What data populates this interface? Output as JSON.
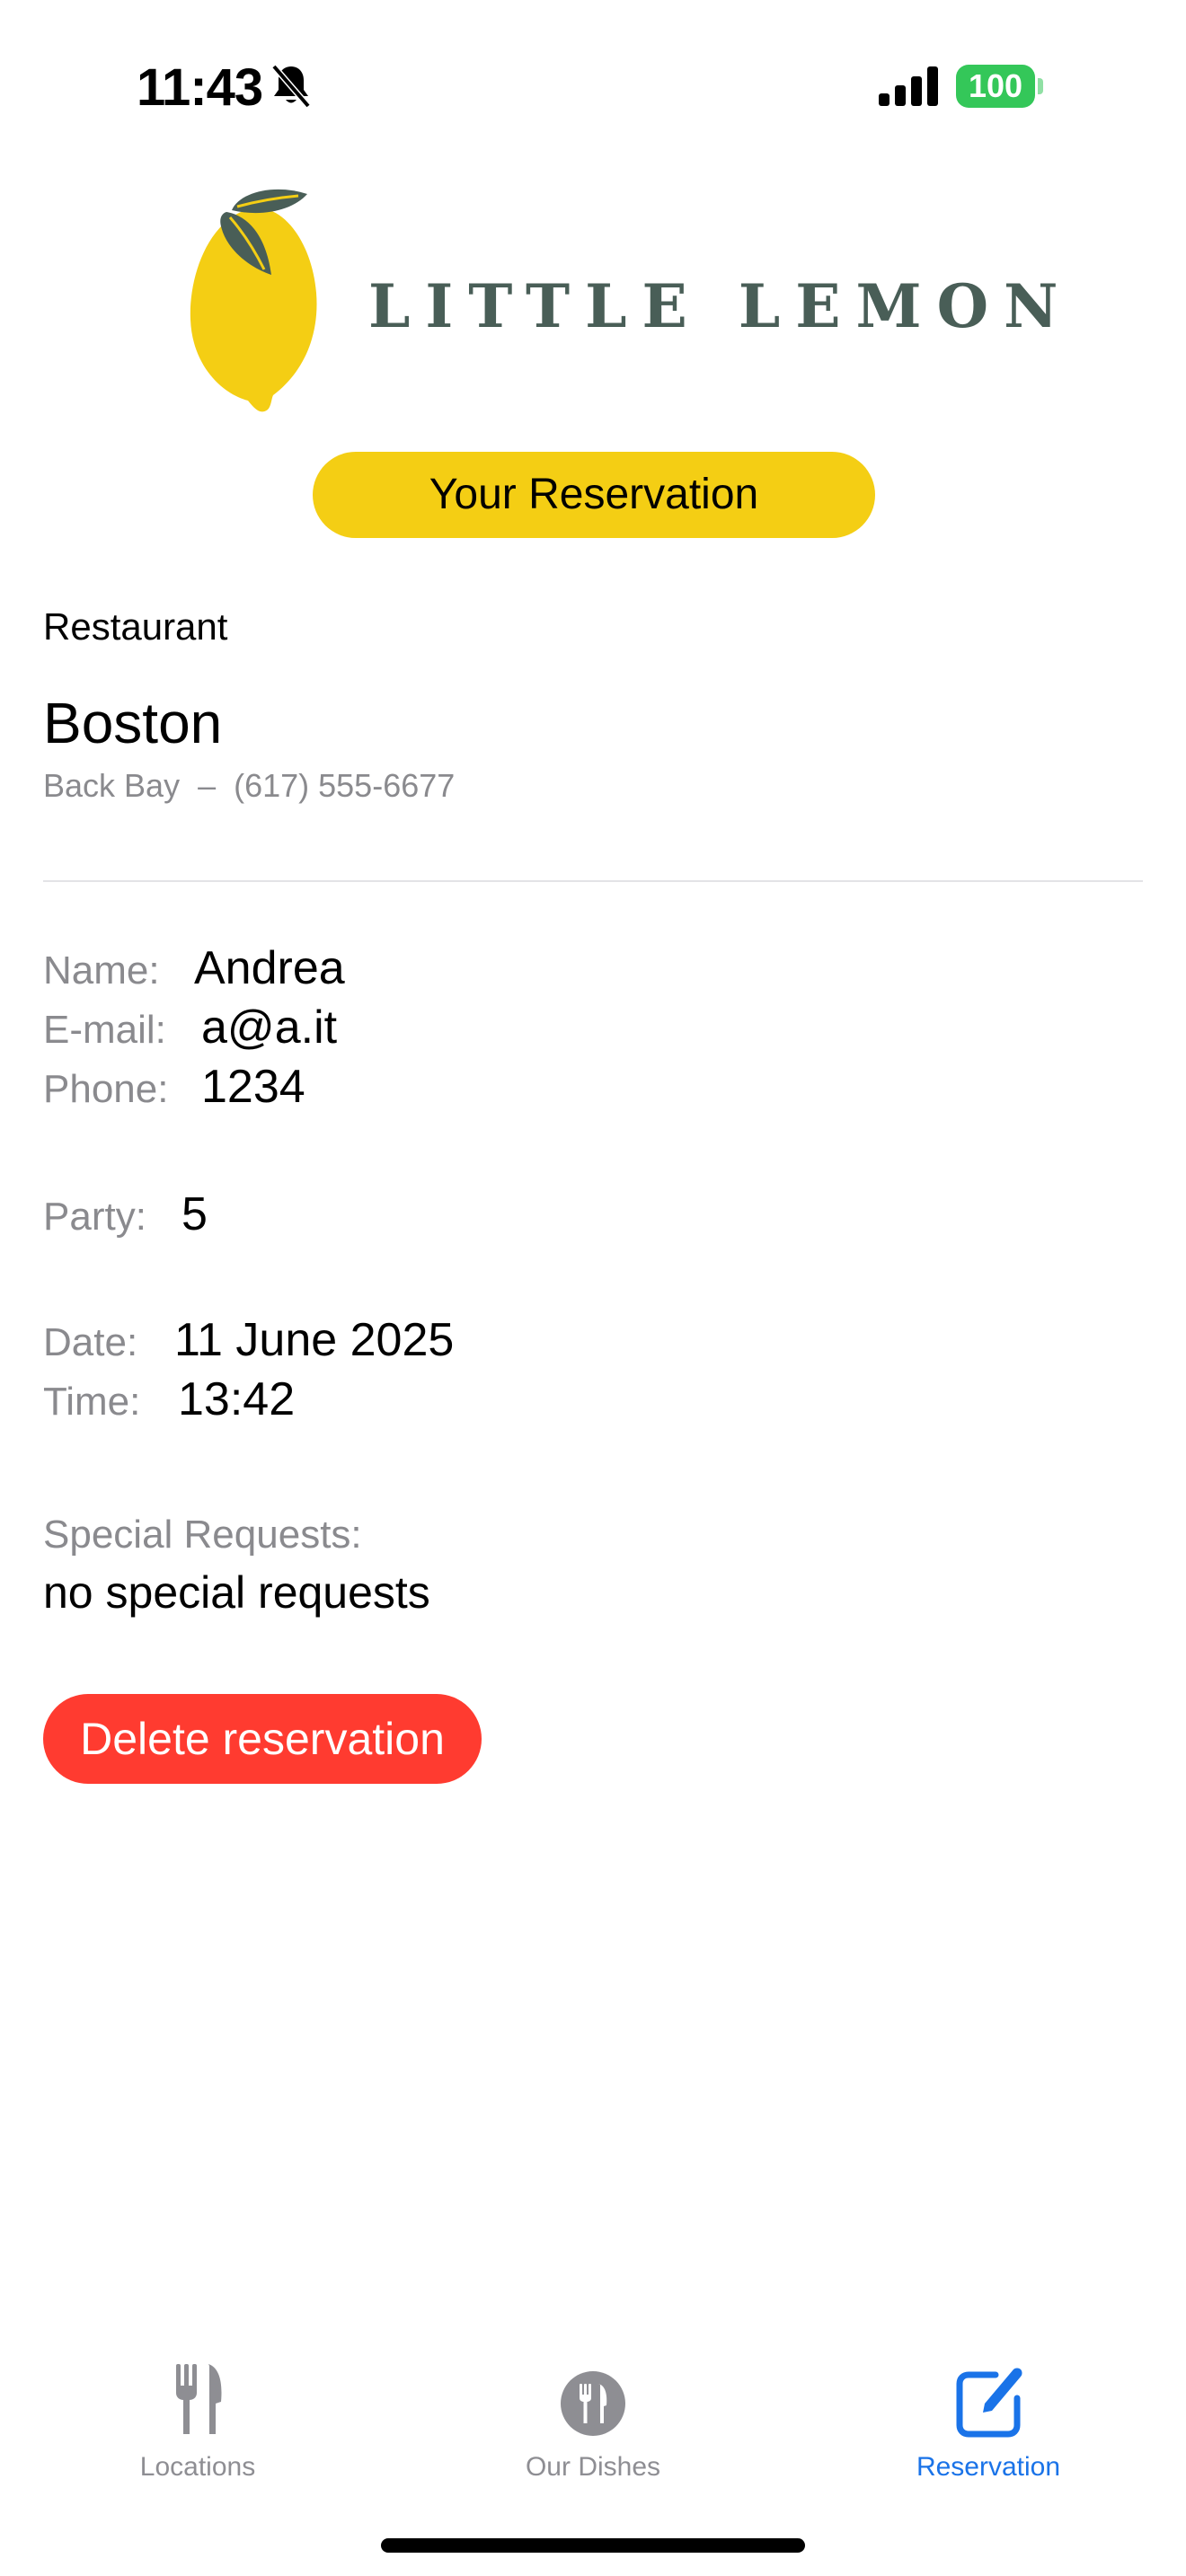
{
  "status_bar": {
    "time": "11:43",
    "battery": "100"
  },
  "logo": {
    "text": "LITTLE LEMON"
  },
  "header": {
    "title": "Your Reservation"
  },
  "restaurant": {
    "section_label": "Restaurant",
    "city": "Boston",
    "neighborhood_phone": "Back Bay  –  (617) 555-6677"
  },
  "reservation": {
    "name_label": "Name:",
    "name": "Andrea",
    "email_label": "E-mail:",
    "email": "a@a.it",
    "phone_label": "Phone:",
    "phone": "1234",
    "party_label": "Party:",
    "party": "5",
    "date_label": "Date:",
    "date": "11 June 2025",
    "time_label": "Time:",
    "time": "13:42",
    "requests_label": "Special Requests:",
    "requests": "no special requests"
  },
  "actions": {
    "delete_label": "Delete reservation"
  },
  "tab_bar": {
    "tabs": [
      {
        "label": "Locations",
        "icon": "fork-knife-icon",
        "active": false
      },
      {
        "label": "Our Dishes",
        "icon": "fork-knife-circle-icon",
        "active": false
      },
      {
        "label": "Reservation",
        "icon": "square-pencil-icon",
        "active": true
      }
    ]
  },
  "colors": {
    "brand_yellow": "#f4ce14",
    "brand_green": "#495e57",
    "danger": "#ff3b30",
    "active_tab": "#1a73e8",
    "inactive_tab": "#8e8e93",
    "battery": "#34c759"
  }
}
